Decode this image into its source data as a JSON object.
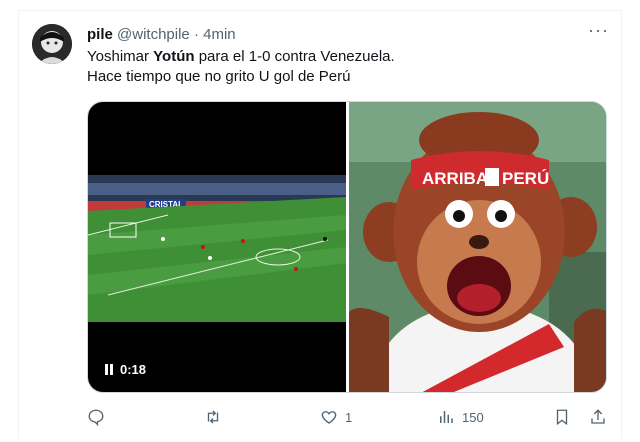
{
  "tweet": {
    "author_name": "pile",
    "author_handle": "@witchpile",
    "separator": "·",
    "time": "4min",
    "line1_prefix": "Yoshimar ",
    "line1_bold": "Yotún",
    "line1_suffix": " para el 1-0 contra Venezuela.",
    "line2": "Hace tiempo que no grito U gol de Perú",
    "more_label": "···"
  },
  "video": {
    "duration": "0:18",
    "scoreboard_text": "CRISTAL"
  },
  "image": {
    "headband_text_left": "ARRIBA",
    "headband_text_right": "PERÚ"
  },
  "actions": {
    "reply_count": "",
    "retweet_count": "",
    "like_count": "1",
    "views_count": "150"
  },
  "colors": {
    "text_primary": "#0f1419",
    "text_secondary": "#536471",
    "border": "#cfd9de"
  }
}
